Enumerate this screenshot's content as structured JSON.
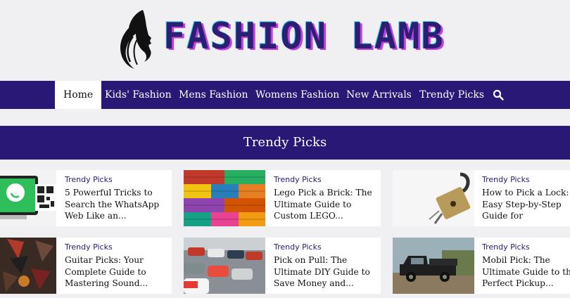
{
  "brand": {
    "name": "FASHION LAMB",
    "primary_color": "#2a1876"
  },
  "nav": {
    "items": [
      "Home",
      "Kids' Fashion",
      "Mens Fashion",
      "Womens Fashion",
      "New Arrivals",
      "Trendy Picks"
    ],
    "active": "Home",
    "search_icon": "search-icon"
  },
  "section": {
    "title": "Trendy Picks"
  },
  "posts": [
    {
      "category": "Trendy Picks",
      "title": "5 Powerful Tricks to Search the WhatsApp Web Like an..."
    },
    {
      "category": "Trendy Picks",
      "title": "Lego Pick a Brick: The Ultimate Guide to Custom LEGO..."
    },
    {
      "category": "Trendy Picks",
      "title": "How to Pick a Lock: Easy Step-by-Step Guide for"
    },
    {
      "category": "Trendy Picks",
      "title": "Guitar Picks: Your Complete Guide to Mastering Sound..."
    },
    {
      "category": "Trendy Picks",
      "title": "Pick on Pull: The Ultimate DIY Guide to Save Money and..."
    },
    {
      "category": "Trendy Picks",
      "title": "Mobil Pick: The Ultimate Guide to the Perfect Pickup..."
    }
  ]
}
